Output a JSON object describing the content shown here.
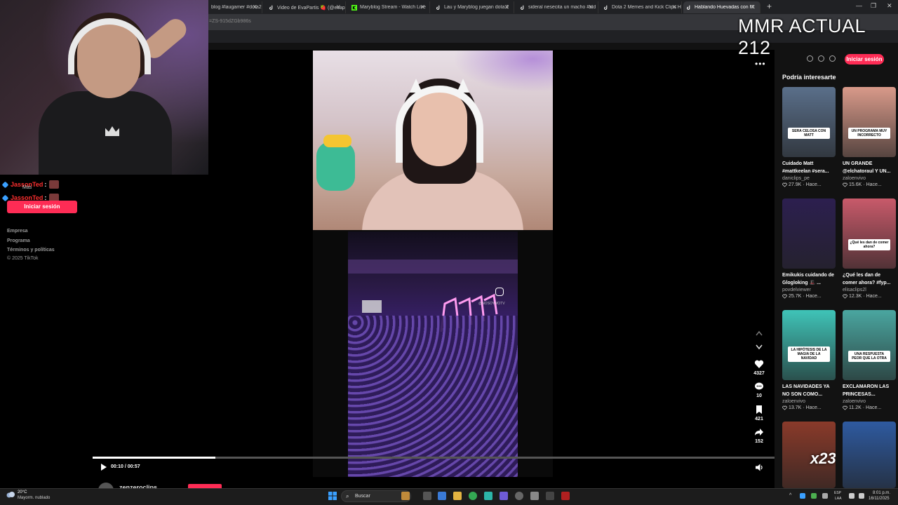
{
  "browser": {
    "tabs": [
      {
        "label": "blog #laugamer #dota2 ",
        "icon_color": "#ffffff"
      },
      {
        "label": "Video de EvaPartis 🍓 (@evapa",
        "icon_color": "#ffffff"
      },
      {
        "label": "Maryblog Stream - Watch Live",
        "icon_color": "#53fc18"
      },
      {
        "label": "Lau y Maryblog juegan dota 2",
        "icon_color": "#ffffff"
      },
      {
        "label": "sideral nesecita un macho #sid",
        "icon_color": "#ffffff"
      },
      {
        "label": "Dota 2 Memes and Kick Clips H",
        "icon_color": "#ffffff"
      },
      {
        "label": "Hablando Huevadas con M",
        "icon_color": "#ffffff",
        "active": true
      }
    ],
    "url": "=ZS-915dZGb986s",
    "overlay_text": "MMR ACTUAL 212"
  },
  "stream_chat": {
    "lines": [
      {
        "name": "JassonTed",
        "colon": ":"
      },
      {
        "name": "JassonTed",
        "colon": ":"
      }
    ],
    "mas": "Mas"
  },
  "sidebar": {
    "login_label": "Iniciar sesión",
    "footer": [
      "Empresa",
      "Programa",
      "Términos y políticas",
      "© 2025 TikTok"
    ]
  },
  "player": {
    "time": "00:10 / 00:57",
    "progress": 0.18,
    "author": "zenzeroclips",
    "handle_watermark": "@NOSOYMOTV"
  },
  "actions": {
    "likes": "4327",
    "comments": "10",
    "saves": "421",
    "shares": "152"
  },
  "right_panel": {
    "login_label": "Iniciar sesión",
    "title": "Podría interesarte",
    "cards": [
      {
        "caption": "Cuidado Matt #mattkeelan #sera...",
        "author": "daniclips_pe",
        "views": "27.9K",
        "ago": "· Hace...",
        "badge": "SERA CELOSA CON MATT",
        "bg": "#5a6f8a"
      },
      {
        "caption": "UN GRANDE @elchatoraul Y UN...",
        "author": "zaloenvivo",
        "views": "15.6K",
        "ago": "· Hace...",
        "badge": "UN PROGRAMA MUY INCORRECTO",
        "bg": "#d99a8a"
      },
      {
        "caption": "Emikukis cuidando de Glogloking 🎩 ...",
        "author": "povdelviewer",
        "views": "25.7K",
        "ago": "· Hace...",
        "badge": "",
        "bg": "#2c1f4f"
      },
      {
        "caption": "¿Qué les dan de comer ahora? #fyp...",
        "author": "elisaclips2l",
        "views": "12.3K",
        "ago": "· Hace...",
        "badge": "¿Qué les dan de comer ahora?",
        "bg": "#c85a6a"
      },
      {
        "caption": "LAS NAVIDADES YA NO SON COMO...",
        "author": "zaloenvivo",
        "views": "13.7K",
        "ago": "· Hace...",
        "badge": "LA HIPÓTESIS DE LA MAGIA DE LA NAVIDAD",
        "bg": "#3fc4b8"
      },
      {
        "caption": "EXCLAMARON LAS PRINCESAS...",
        "author": "zaloenvivo",
        "views": "11.2K",
        "ago": "· Hace...",
        "badge": "UNA RESPUESTA PEOR QUE LA OTRA",
        "bg": "#4aa6a0"
      },
      {
        "caption": "",
        "author": "",
        "views": "",
        "ago": "",
        "badge": "",
        "overlay": "x23",
        "bg": "#8a3a2a"
      },
      {
        "caption": "",
        "author": "",
        "views": "",
        "ago": "",
        "badge": "",
        "bg": "#2e5aa0"
      }
    ]
  },
  "taskbar": {
    "temp": "20°C",
    "weather": "Mayorm. nublado",
    "search_label": "Buscar",
    "lang_line1": "ESP",
    "lang_line2": "LAA",
    "time": "8:01 p.m.",
    "date": "16/11/2025"
  },
  "colors": {
    "accent": "#fe2c55",
    "background": "#121212"
  }
}
